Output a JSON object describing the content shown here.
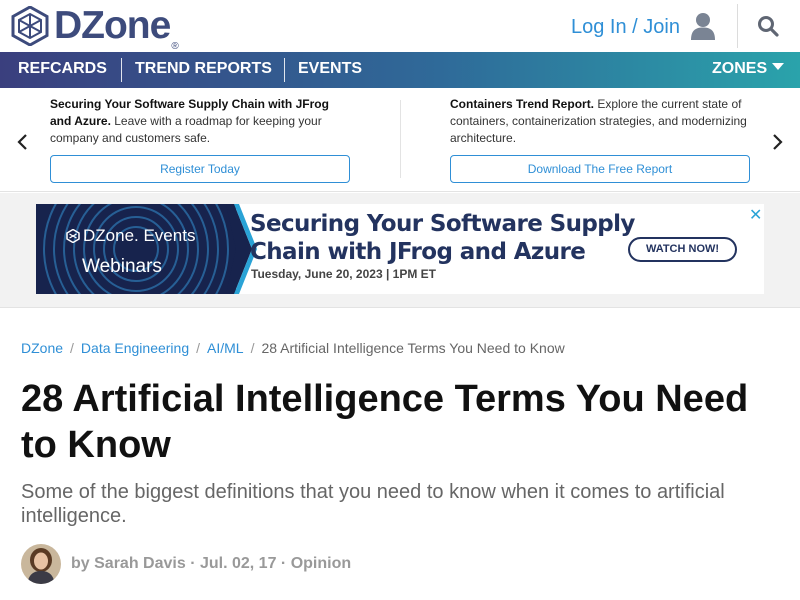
{
  "header": {
    "logo_text": "DZone",
    "logo_mark": "®",
    "login_label": "Log In / Join",
    "icons": [
      "user-icon",
      "search-icon"
    ]
  },
  "nav": {
    "items": [
      {
        "label": "REFCARDS"
      },
      {
        "label": "TREND REPORTS"
      },
      {
        "label": "EVENTS"
      }
    ],
    "zones_label": "ZONES"
  },
  "promo": {
    "left": {
      "title": "Securing Your Software Supply Chain with JFrog and Azure.",
      "body": "Leave with a roadmap for keeping your company and customers safe.",
      "button": "Register Today"
    },
    "right": {
      "title": "Containers Trend Report.",
      "body": "Explore the current state of containers, containerization strategies, and modernizing architecture.",
      "button": "Download The Free Report"
    }
  },
  "ad": {
    "brand": "DZone. Events",
    "label": "Webinars",
    "title_line1": "Securing Your Software Supply",
    "title_line2": "Chain with JFrog and Azure",
    "date": "Tuesday, June 20, 2023 | 1PM ET",
    "cta": "WATCH NOW!",
    "close": "✕"
  },
  "article": {
    "breadcrumb": [
      {
        "label": "DZone"
      },
      {
        "label": "Data Engineering"
      },
      {
        "label": "AI/ML"
      },
      {
        "label": "28 Artificial Intelligence Terms You Need to Know"
      }
    ],
    "separator": "/",
    "title": "28 Artificial Intelligence Terms You Need to Know",
    "subtitle": "Some of the biggest definitions that you need to know when it comes to artificial intelligence.",
    "byline": {
      "prefix": "by",
      "author": "Sarah Davis",
      "sep": "·",
      "date": "Jul. 02, 17",
      "category": "Opinion"
    }
  },
  "colors": {
    "brand": "#3d4b7c",
    "link": "#2f8fd6",
    "nav_start": "#3a3f7e",
    "nav_end": "#2aa3ab"
  }
}
